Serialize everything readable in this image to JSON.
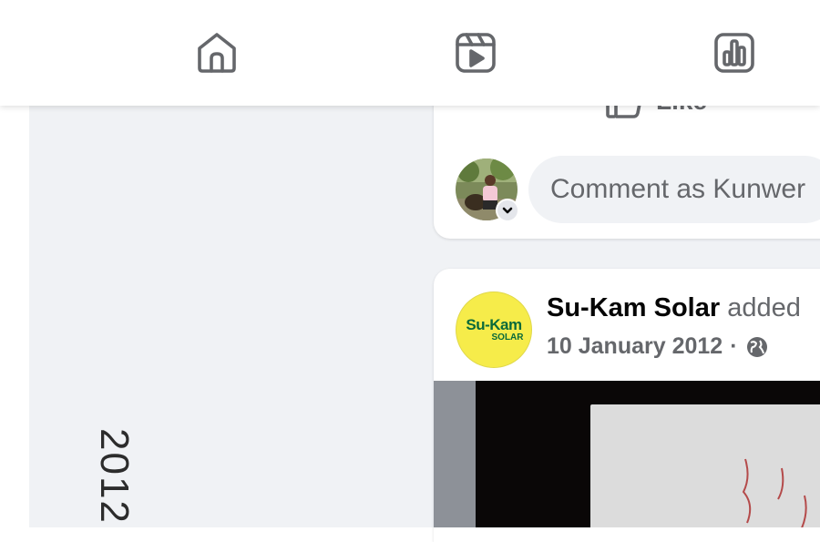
{
  "nav": {
    "items": [
      {
        "name": "home",
        "icon": "home-icon"
      },
      {
        "name": "reels",
        "icon": "reels-icon"
      },
      {
        "name": "insights",
        "icon": "bar-chart-icon"
      }
    ],
    "icon_color": "#65676b"
  },
  "post1": {
    "like_label": "Like",
    "comment_placeholder": "Comment as Kunwer"
  },
  "post2": {
    "author": "Su-Kam Solar",
    "action": "added",
    "date": "10 January 2012",
    "separator": "·",
    "privacy_icon": "globe-icon",
    "logo_text_main": "Su-Kam",
    "logo_text_sub": "SOLAR",
    "photo_year_text": "2012"
  },
  "colors": {
    "feed_background": "#f0f2f5",
    "card": "#ffffff",
    "secondary_text": "#65676b",
    "logo_yellow": "#f6ec4a",
    "logo_green": "#0a6a3a"
  }
}
